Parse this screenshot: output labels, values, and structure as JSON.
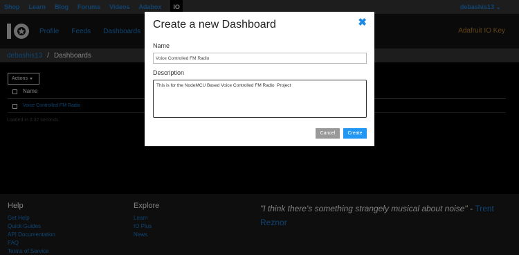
{
  "topnav": {
    "links": [
      "Shop",
      "Learn",
      "Blog",
      "Forums",
      "Videos",
      "Adabox"
    ],
    "active_tab": "IO",
    "user": "debashis13 ⌄"
  },
  "header": {
    "nav": [
      "Profile",
      "Feeds",
      "Dashboards"
    ],
    "io_key": "Adafruit IO Key"
  },
  "breadcrumb": {
    "user": "debashis13",
    "separator": "/",
    "current": "Dashboards"
  },
  "table": {
    "actions_label": "Actions",
    "column_name": "Name",
    "rows": [
      "Voice Controlled FM Radio"
    ],
    "loaded_text": "Loaded in 0.32 seconds."
  },
  "footer": {
    "help": {
      "title": "Help",
      "links": [
        "Get Help",
        "Quick Guides",
        "API Documentation",
        "FAQ",
        "Terms of Service"
      ]
    },
    "explore": {
      "title": "Explore",
      "links": [
        "Learn",
        "IO Plus",
        "News"
      ]
    },
    "quote": {
      "text": "\"I think there's something strangely musical about noise\" -",
      "author": "Trent Reznor"
    }
  },
  "modal": {
    "title": "Create a new Dashboard",
    "close": "✖",
    "name_label": "Name",
    "name_value": "Voice Controlled FM Radio",
    "description_label": "Description",
    "description_value": "This is for the NodeMCU Based Voice Controlled FM Radio  Project",
    "cancel_label": "Cancel",
    "create_label": "Create"
  },
  "colors": {
    "accent": "#1e88e5",
    "io_key": "#c98b2a",
    "create_button": "#2196f3",
    "cancel_button": "#999999"
  }
}
